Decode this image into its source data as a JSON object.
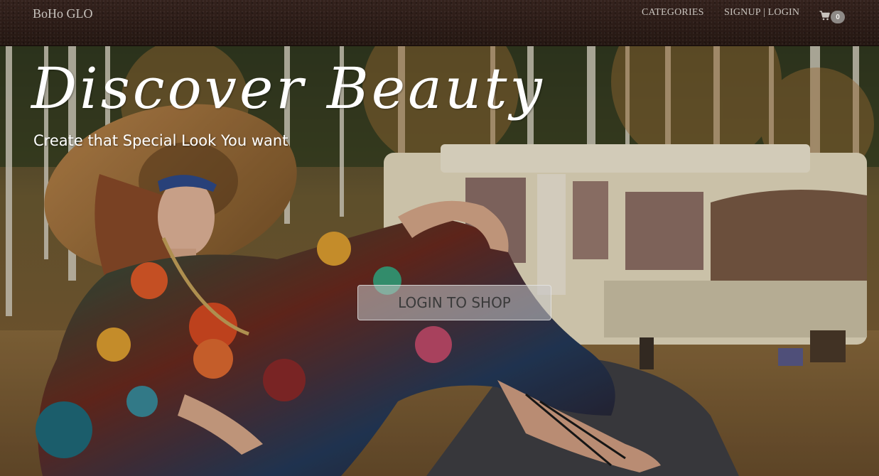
{
  "navbar": {
    "brand": "BoHo GLO",
    "links": [
      {
        "label": "CATEGORIES"
      },
      {
        "label": "SIGNUP | LOGIN"
      }
    ],
    "cart": {
      "icon": "shopping-cart-icon",
      "count": "0"
    }
  },
  "hero": {
    "title": "Discover Beauty",
    "subtitle": "Create that Special Look You want",
    "cta_label": "LOGIN TO SHOP"
  },
  "colors": {
    "navbar_bg": "#2b1b17",
    "nav_text": "#c9c4be",
    "badge_bg": "#8e8a87",
    "hero_text": "#ffffff",
    "cta_bg": "#c8c8c8",
    "cta_text": "#3a3a3a"
  }
}
